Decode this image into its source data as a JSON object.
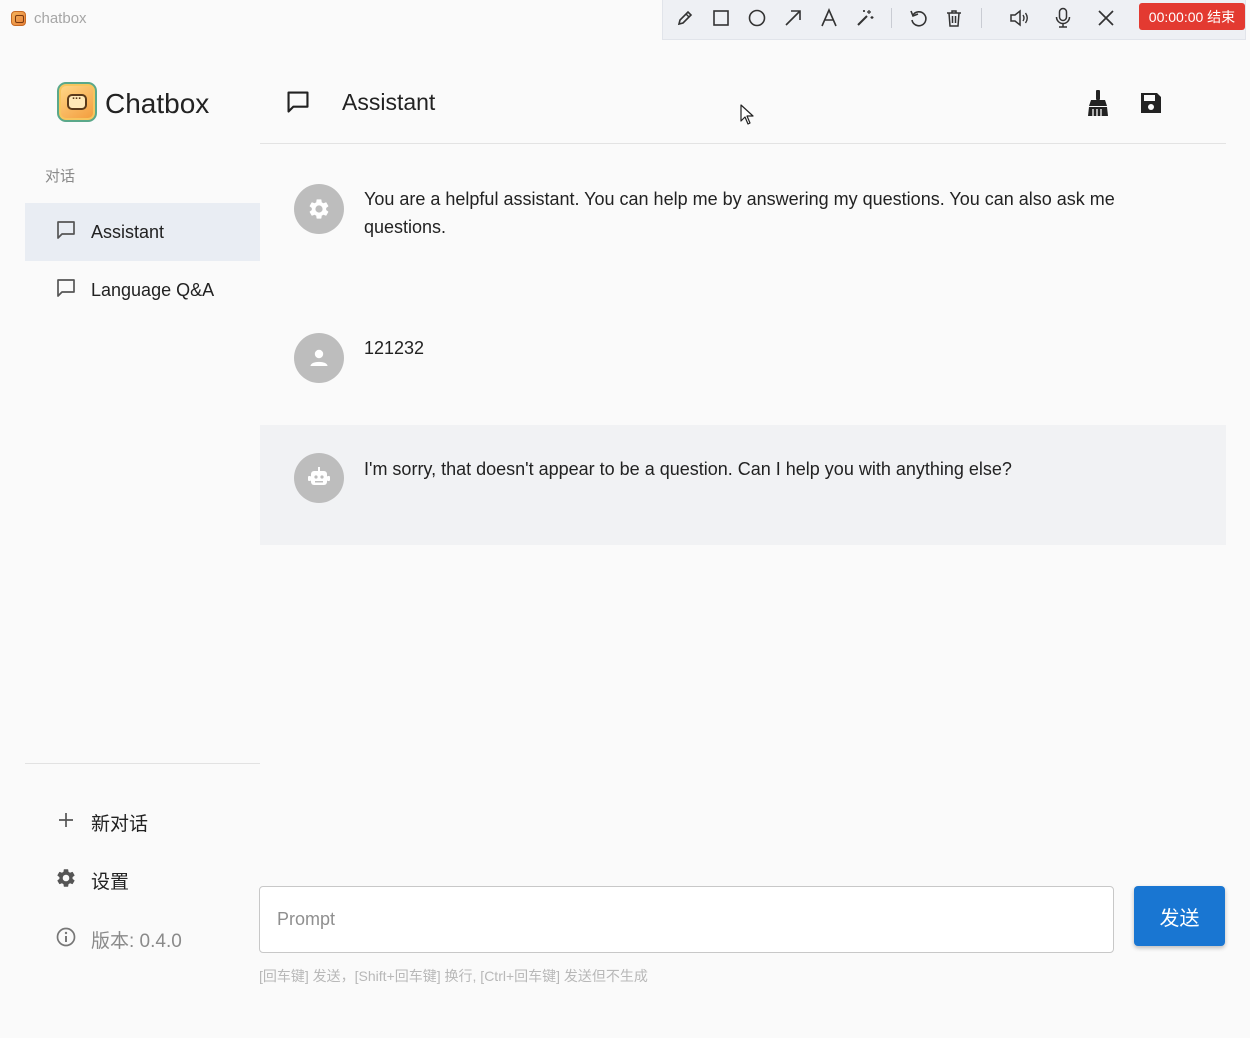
{
  "window": {
    "title": "chatbox"
  },
  "recorder": {
    "tools": [
      "pencil-icon",
      "rectangle-icon",
      "circle-icon",
      "arrow-icon",
      "text-icon",
      "magic-wand-icon",
      "undo-icon",
      "trash-icon",
      "speaker-icon",
      "microphone-icon",
      "close-icon"
    ],
    "timer_label": "00:00:00 结束",
    "timer_color": "#e33a31"
  },
  "sidebar": {
    "brand": "Chatbox",
    "section_label": "对话",
    "conversations": [
      {
        "label": "Assistant",
        "active": true
      },
      {
        "label": "Language Q&A",
        "active": false
      }
    ],
    "new_chat_label": "新对话",
    "settings_label": "设置",
    "version_label": "版本: 0.4.0"
  },
  "header": {
    "title": "Assistant",
    "clean_icon": "broom-icon",
    "save_icon": "save-icon"
  },
  "messages": [
    {
      "role": "system",
      "avatar_icon": "gear-icon",
      "text": "You are a helpful assistant. You can help me by answering my questions. You can also ask me questions."
    },
    {
      "role": "user",
      "avatar_icon": "person-icon",
      "text": "121232"
    },
    {
      "role": "assistant",
      "avatar_icon": "robot-icon",
      "text": "I'm sorry, that doesn't appear to be a question. Can I help you with anything else?"
    }
  ],
  "input": {
    "placeholder": "Prompt",
    "value": "",
    "send_label": "发送",
    "hint": "[回车键] 发送，[Shift+回车键] 换行, [Ctrl+回车键] 发送但不生成"
  },
  "colors": {
    "accent": "#1976d2",
    "active_item_bg": "#e9edf3",
    "avatar_bg": "#bdbdbd"
  }
}
